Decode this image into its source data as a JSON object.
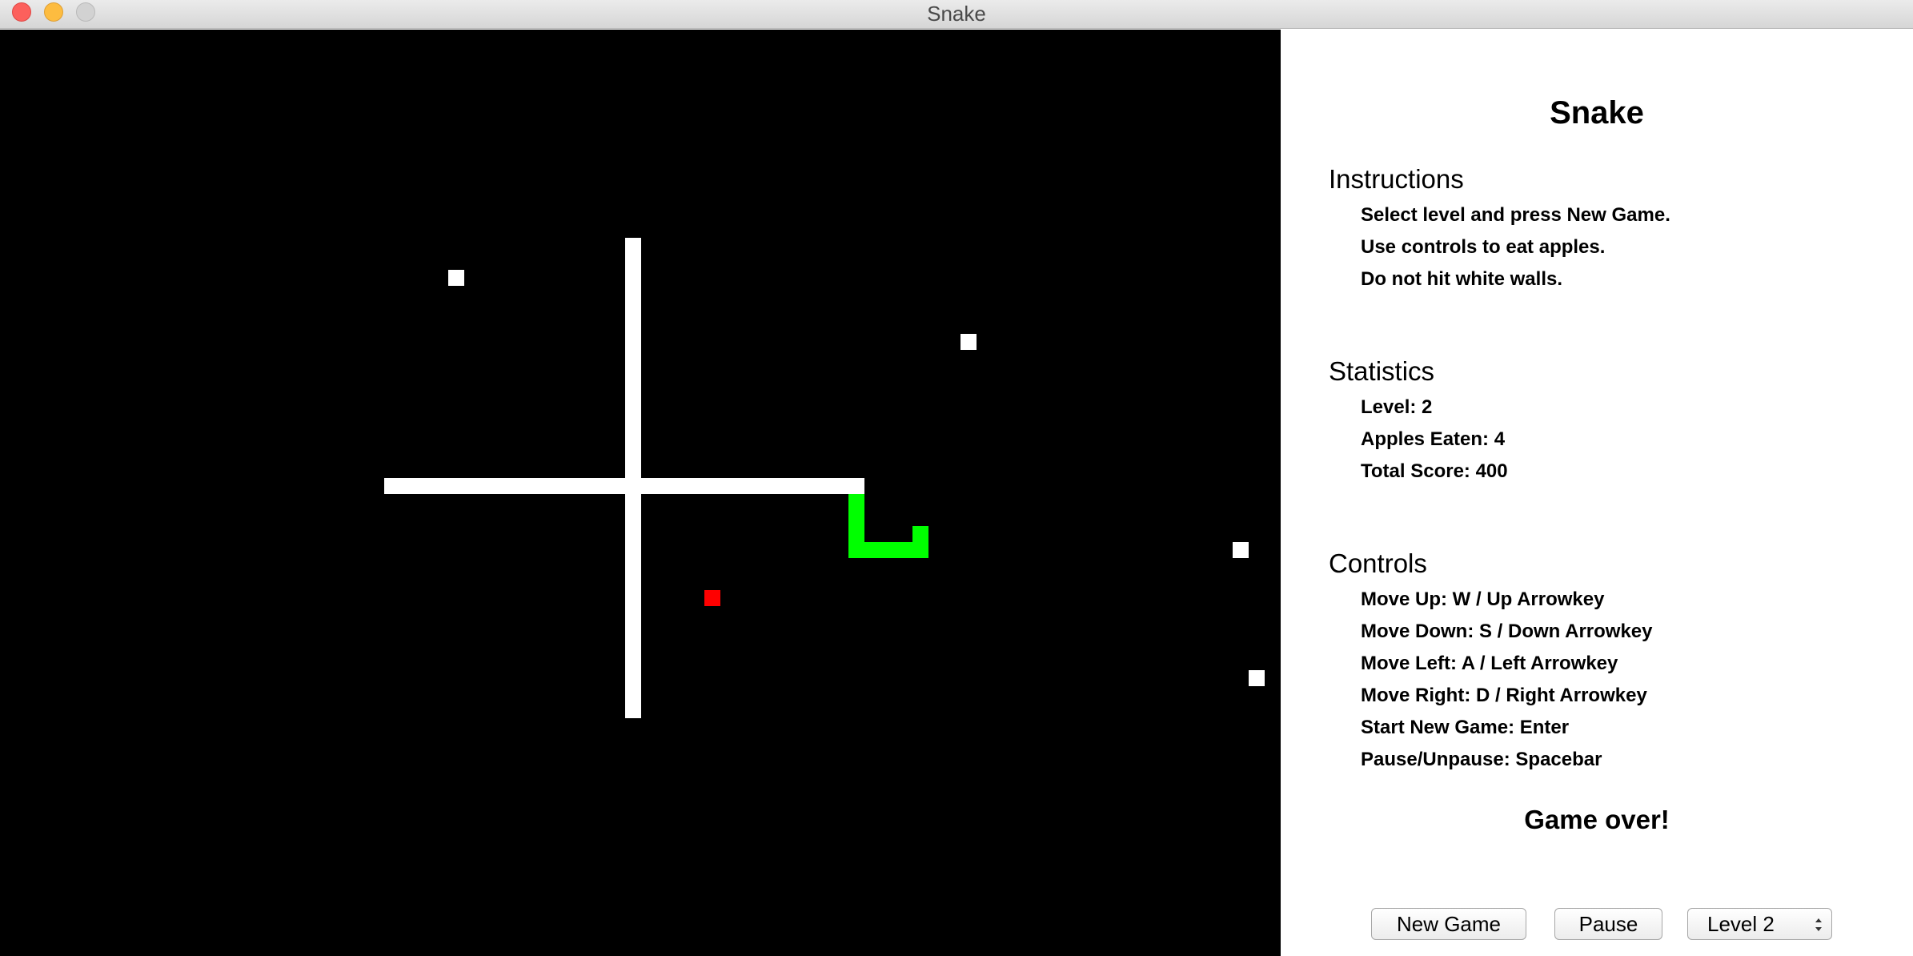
{
  "window": {
    "title": "Snake"
  },
  "panel": {
    "title": "Snake",
    "instructions": {
      "heading": "Instructions",
      "lines": [
        "Select level and press New Game.",
        "Use controls to eat apples.",
        "Do not hit white walls."
      ]
    },
    "statistics": {
      "heading": "Statistics",
      "lines": [
        "Level: 2",
        "Apples Eaten: 4",
        "Total Score: 400"
      ]
    },
    "controls": {
      "heading": "Controls",
      "lines": [
        "Move Up: W / Up Arrowkey",
        "Move Down: S / Down Arrowkey",
        "Move Left: A / Left Arrowkey",
        "Move Right: D / Right Arrowkey",
        "Start New Game: Enter",
        "Pause/Unpause: Spacebar"
      ]
    },
    "status": "Game over!",
    "buttons": {
      "new_game": "New Game",
      "pause": "Pause"
    },
    "level_select": {
      "value": "Level 2"
    }
  },
  "colors": {
    "board": "#000000",
    "wall": "#ffffff",
    "snake": "#00ff00",
    "apple": "#ff0000"
  },
  "icons": {
    "close": "close-icon",
    "minimize": "minimize-icon",
    "zoom": "zoom-icon",
    "select_arrows": "updown-chevron-icon"
  }
}
